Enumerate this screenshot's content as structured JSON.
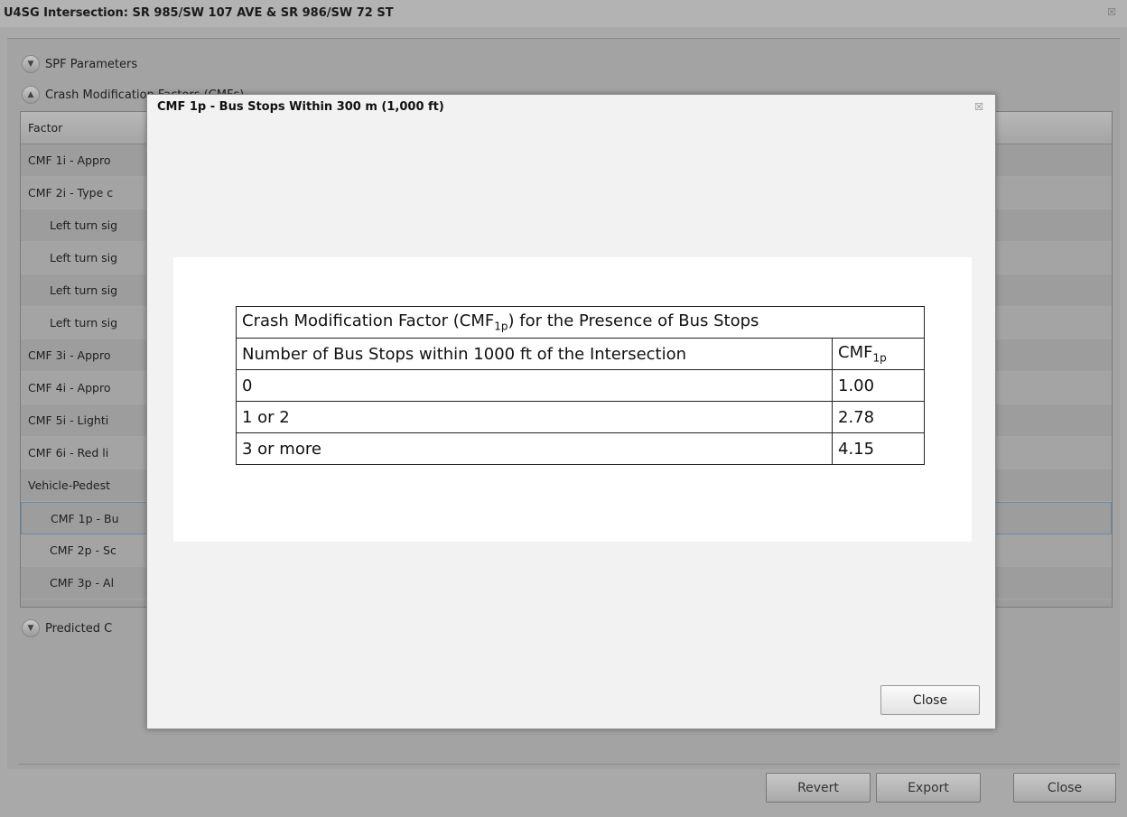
{
  "window": {
    "title": "U4SG Intersection: SR 985/SW 107 AVE & SR 986/SW 72 ST",
    "close_glyph": "☒"
  },
  "sections": {
    "spf": "SPF Parameters",
    "cmf": "Crash Modification Factors (CMFs)",
    "predicted": "Predicted C"
  },
  "factor_table": {
    "header": "Factor",
    "rows": [
      "CMF 1i - Appro",
      "CMF 2i - Type c",
      "Left turn sig",
      "Left turn sig",
      "Left turn sig",
      "Left turn sig",
      "CMF 3i - Appro",
      "CMF 4i - Appro",
      "CMF 5i - Lighti",
      "CMF 6i - Red li",
      "Vehicle-Pedest",
      "CMF 1p - Bu",
      "CMF 2p - Sc",
      "CMF 3p - Al"
    ]
  },
  "buttons": {
    "revert": "Revert",
    "export": "Export",
    "close": "Close"
  },
  "dialog": {
    "title": "CMF 1p - Bus Stops Within 300 m (1,000 ft)",
    "close_glyph": "☒",
    "close_button": "Close",
    "table": {
      "caption_pre": "Crash Modification Factor (CMF",
      "caption_sub": "1p",
      "caption_post": ") for the Presence of Bus Stops",
      "col1_header": "Number of Bus Stops within 1000 ft of the Intersection",
      "col2_header_pre": "CMF",
      "col2_header_sub": "1p",
      "rows": [
        {
          "stops": "0",
          "cmf": "1.00"
        },
        {
          "stops": "1 or 2",
          "cmf": "2.78"
        },
        {
          "stops": "3 or more",
          "cmf": "4.15"
        }
      ]
    }
  }
}
